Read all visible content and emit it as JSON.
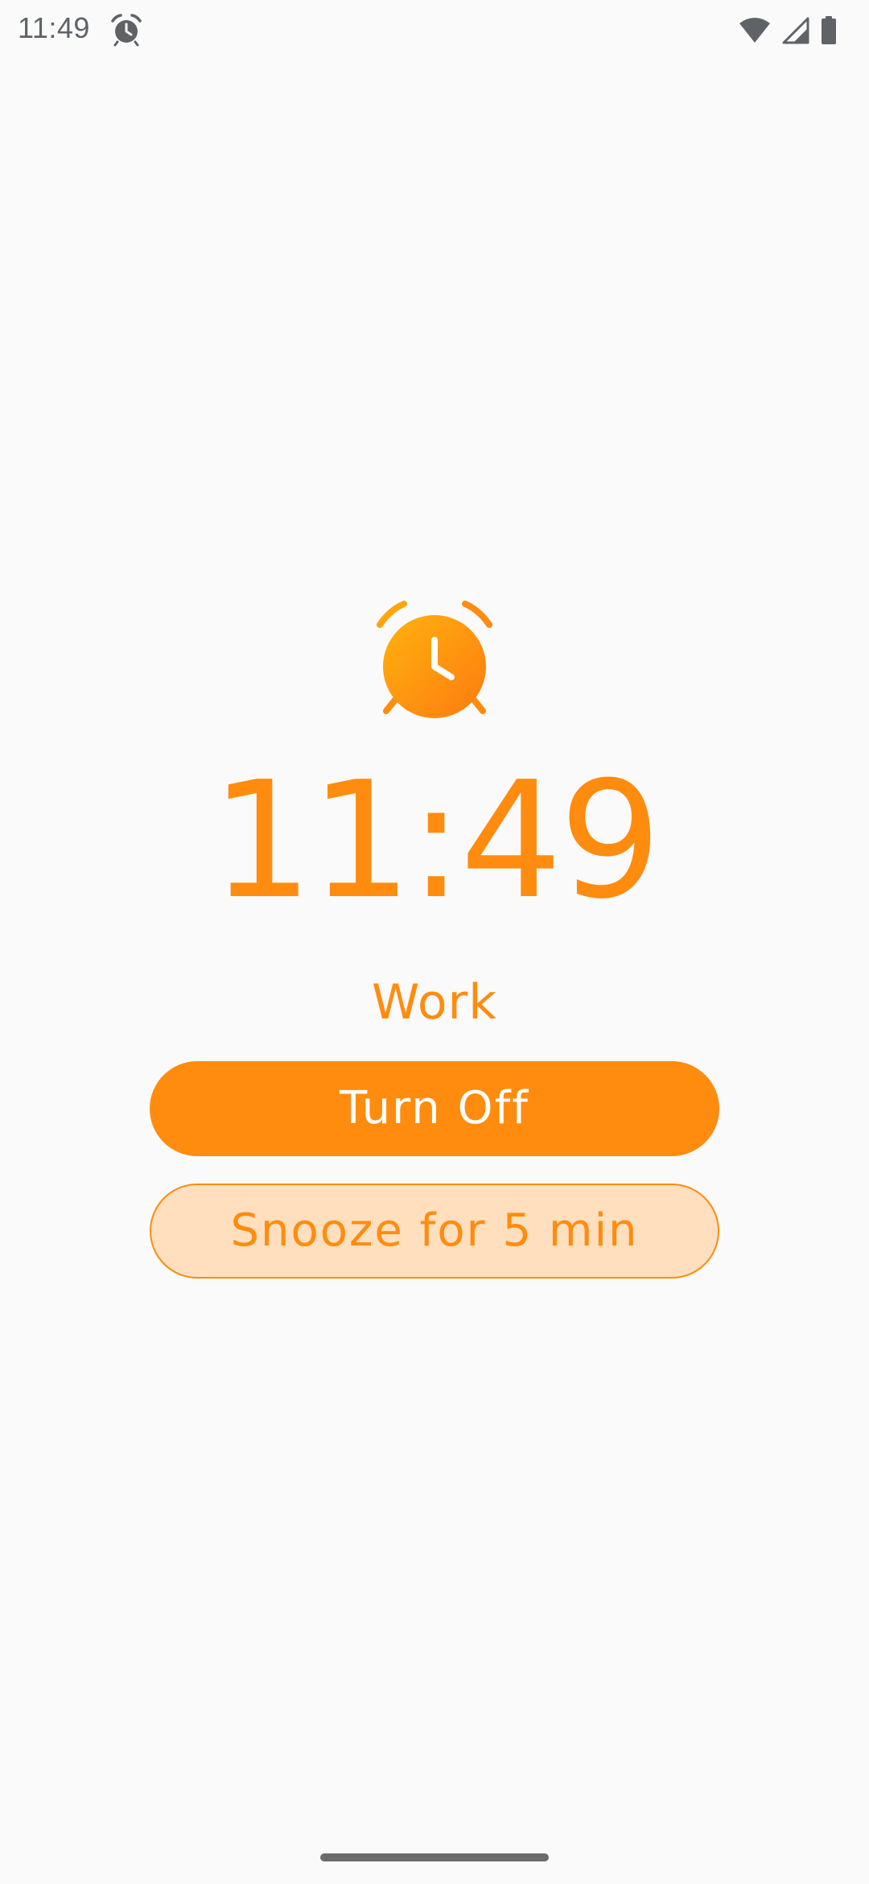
{
  "status_bar": {
    "time": "11:49",
    "icons": [
      "alarm-clock-icon",
      "wifi-icon",
      "cellular-signal-icon",
      "battery-icon"
    ]
  },
  "alarm": {
    "icon": "alarm-clock-icon",
    "time": "11:49",
    "label": "Work"
  },
  "actions": {
    "turn_off_label": "Turn Off",
    "snooze_label": "Snooze for 5 min"
  },
  "colors": {
    "accent": "#ff8c0f",
    "accent_light": "#ffdfbd",
    "background": "#fafafa",
    "status_icon": "#5f6368"
  }
}
